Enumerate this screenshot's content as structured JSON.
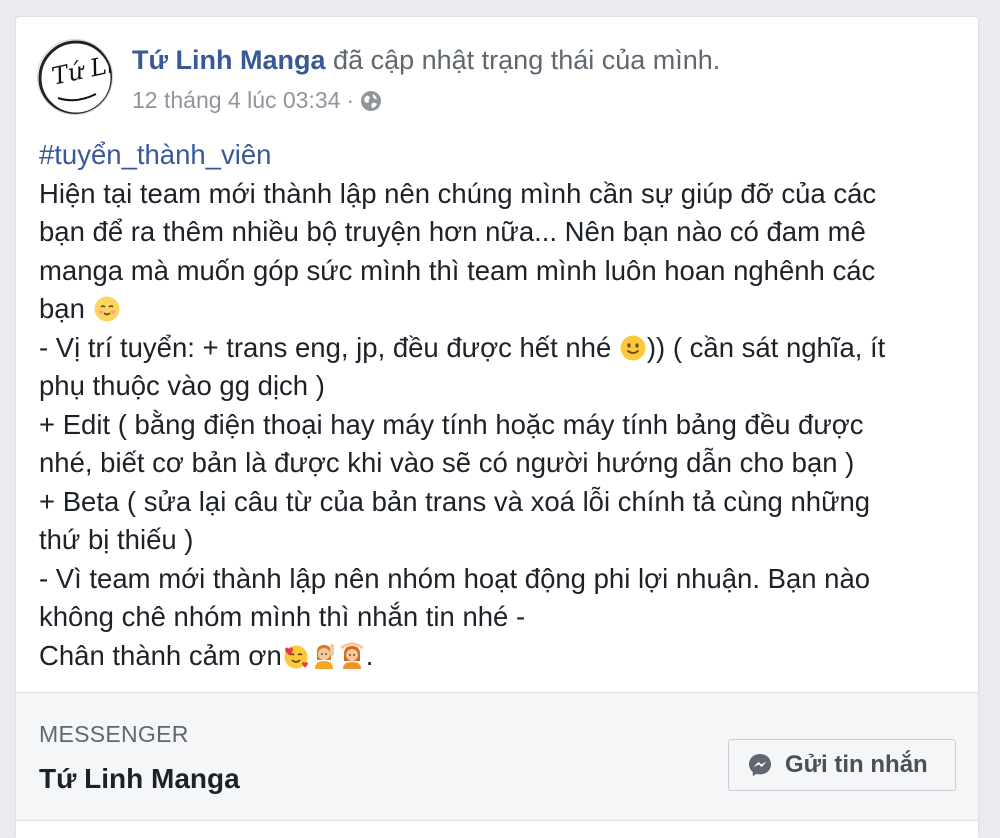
{
  "post": {
    "author": "Tứ Linh Manga",
    "action": " đã cập nhật trạng thái của mình.",
    "timestamp": "12 tháng 4 lúc 03:34",
    "separator": "·",
    "privacy_icon": "globe-icon",
    "avatar_text": "Tứ Linh",
    "lines": {
      "hashtag": "#tuyển_thành_viên",
      "l1": "Hiện tại team mới thành lập nên chúng mình cần sự giúp đỡ của các",
      "l2": "bạn để ra thêm nhiều bộ truyện hơn nữa... Nên bạn nào có đam mê",
      "l3": "manga mà muốn góp sức mình thì team mình luôn hoan nghênh các",
      "l4": "bạn ",
      "l5a": "- Vị trí tuyển: + trans eng, jp, đều được hết nhé ",
      "l5b": ")) ( cần sát nghĩa, ít",
      "l6": "phụ thuộc vào gg dịch )",
      "l7": "+ Edit ( bằng điện thoại hay máy tính hoặc máy tính bảng đều được",
      "l8": "nhé, biết cơ bản là được khi vào sẽ có người hướng dẫn cho bạn )",
      "l9": "+ Beta ( sửa lại câu từ của bản trans và xoá lỗi chính tả cùng những",
      "l10": "thứ bị thiếu )",
      "l11": "- Vì team mới thành lập nên nhóm hoạt động phi lợi nhuận. Bạn nào",
      "l12": "không chê nhóm mình thì nhắn tin nhé -",
      "l13a": "Chân thành cảm ơn",
      "l13b": "."
    },
    "emojis": [
      "blushing-face-emoji",
      "slightly-smiling-face-emoji",
      "smiling-face-with-hearts-emoji",
      "person-raising-hand-emoji",
      "person-gesturing-ok-emoji"
    ]
  },
  "messenger": {
    "section_label": "MESSENGER",
    "page_name": "Tứ Linh Manga",
    "button_label": "Gửi tin nhắn",
    "button_icon": "messenger-icon"
  },
  "colors": {
    "link": "#385898",
    "text": "#1d2129",
    "meta": "#90949c",
    "background": "#e9ebee",
    "footer": "#f5f6f7"
  }
}
